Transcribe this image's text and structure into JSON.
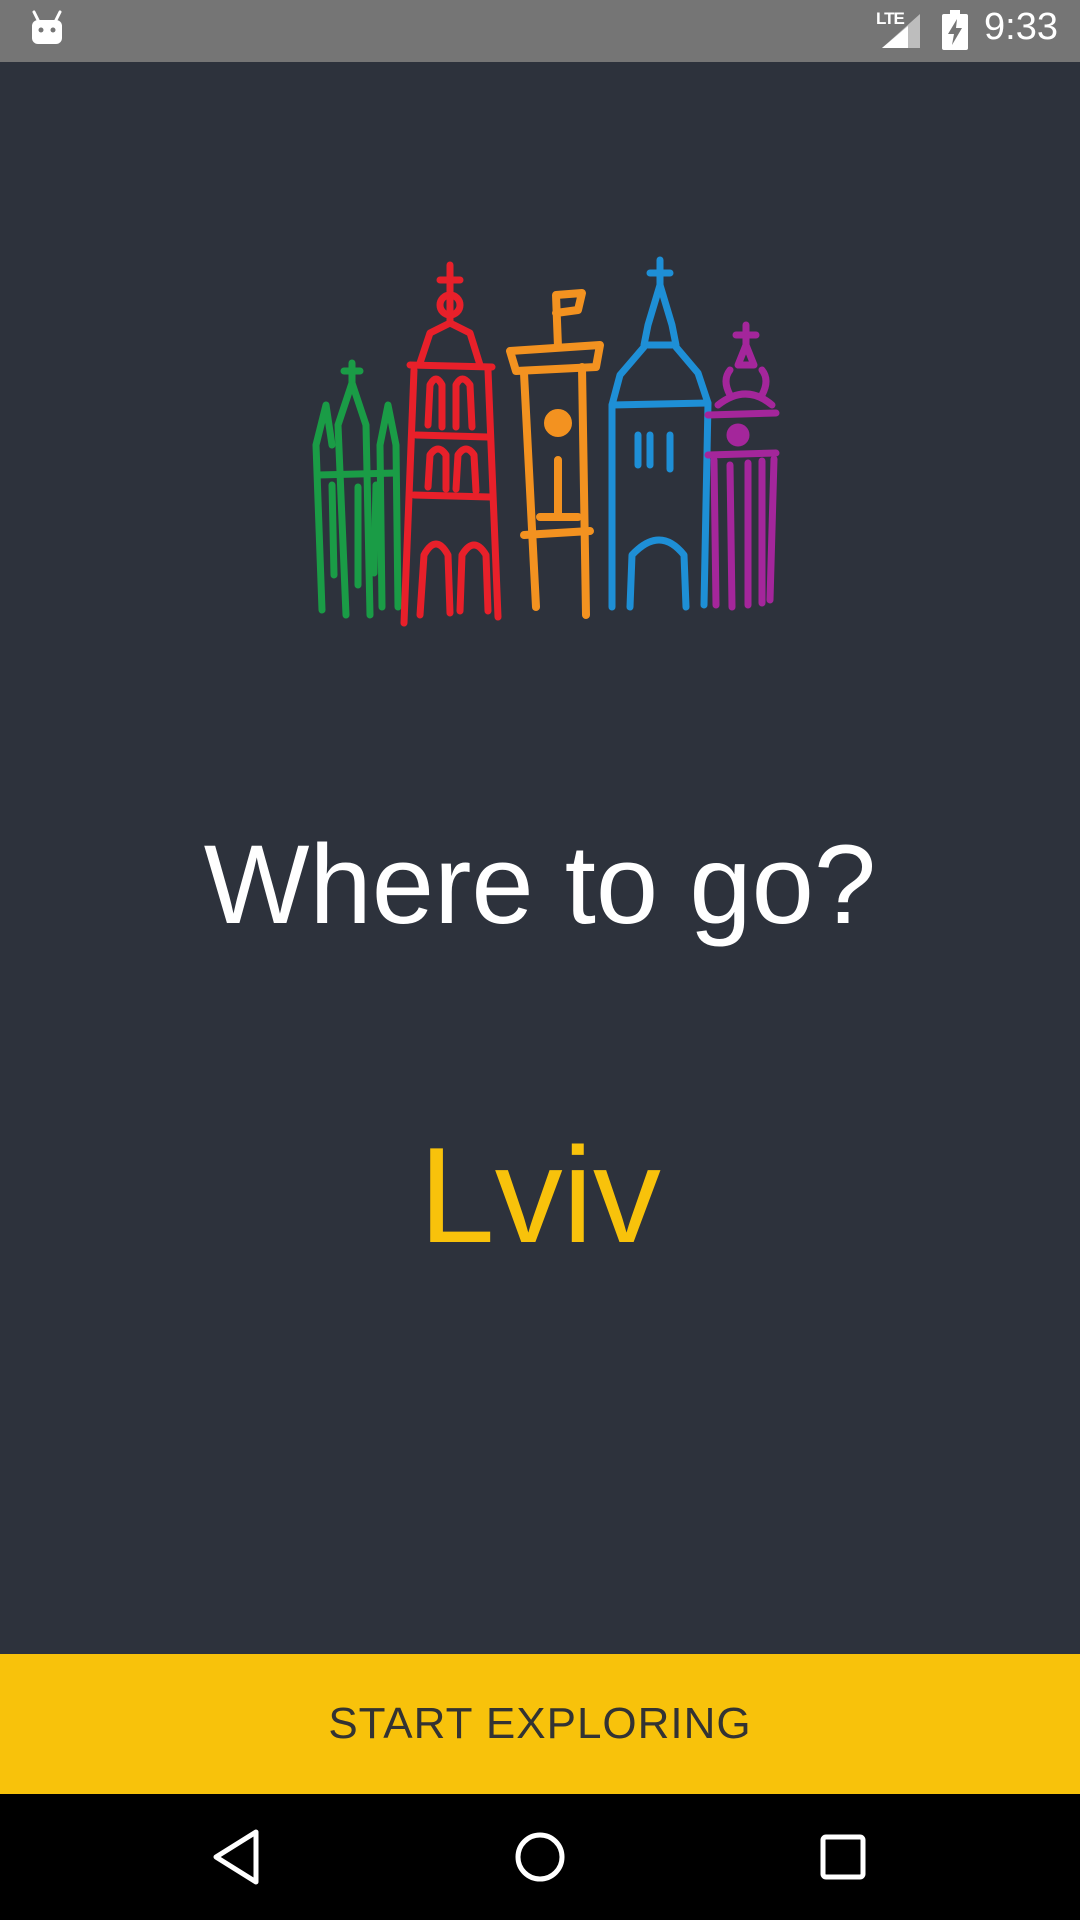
{
  "status_bar": {
    "network": "LTE",
    "time": "9:33",
    "icons": [
      "android-icon",
      "signal-icon",
      "battery-charging-icon"
    ]
  },
  "main": {
    "logo_icon": "lviv-city-towers-logo",
    "headline": "Where to go?",
    "city": "Lviv"
  },
  "cta": {
    "label": "START EXPLORING"
  },
  "nav_bar": {
    "icons": [
      "back-icon",
      "home-icon",
      "recents-icon"
    ]
  },
  "colors": {
    "background": "#2d323c",
    "accent": "#f8c20b",
    "status_bar": "#757575",
    "nav_bar": "#000000",
    "logo": [
      "#1a9c46",
      "#e8202a",
      "#f39220",
      "#1e8fd6",
      "#a4269b"
    ]
  }
}
